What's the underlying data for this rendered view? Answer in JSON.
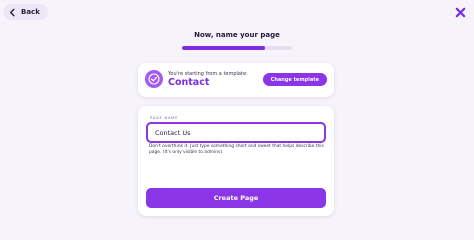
{
  "nav": {
    "back_label": "Back",
    "back_icon": "chevron-left-icon",
    "close_icon": "close-icon"
  },
  "header": {
    "title": "Now, name your page",
    "progress": 0.75
  },
  "template": {
    "caption": "You're starting from a template:",
    "name": "Contact",
    "change_label": "Change template",
    "icon": "check-circle-icon"
  },
  "form": {
    "field_label": "PAGE NAME",
    "field_value": "Contact Us",
    "helper_text": "Don't overthink it. Just type something short and sweet that helps describe this page. (It's only visible to admins).",
    "submit_label": "Create Page"
  },
  "colors": {
    "accent": "#8a35e6",
    "accent_dark": "#7b2fe0",
    "badge": "#a35bf0",
    "track": "#e6dcf4",
    "background": "#f6f4fa"
  }
}
